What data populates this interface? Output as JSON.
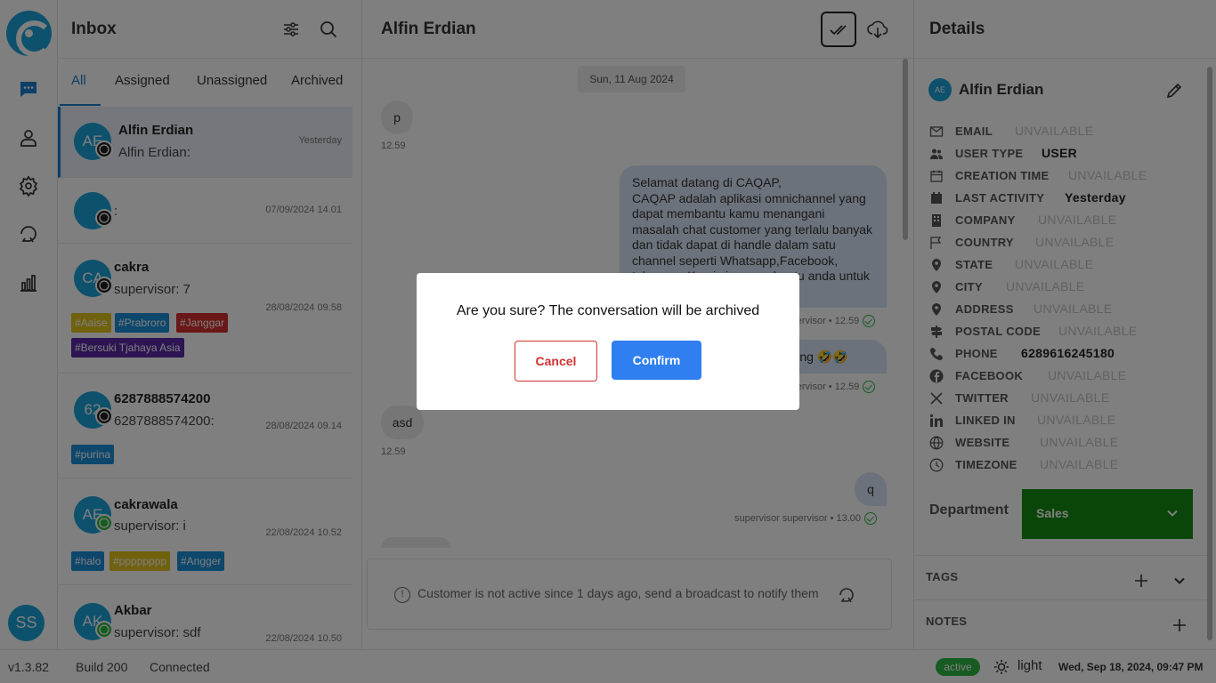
{
  "brand": {
    "accent": "#1aa3d8"
  },
  "rail": {
    "user_initials": "SS"
  },
  "inbox": {
    "title": "Inbox",
    "tabs": [
      {
        "label": "All",
        "active": true
      },
      {
        "label": "Assigned",
        "active": false
      },
      {
        "label": "Unassigned",
        "active": false
      },
      {
        "label": "Archived",
        "active": false
      }
    ],
    "conversations": [
      {
        "initials": "AE",
        "name": "Alfin Erdian",
        "preview": "Alfin Erdian:",
        "time": "Yesterday",
        "channel": "whatsapp-business",
        "selected": true,
        "tags": []
      },
      {
        "initials": "",
        "name": "",
        "preview": ":",
        "time": "07/09/2024 14.01",
        "channel": "whatsapp-business",
        "selected": false,
        "tags": []
      },
      {
        "initials": "CA",
        "name": "cakra",
        "preview": "supervisor:  7",
        "time": "28/08/2024 09.58",
        "channel": "whatsapp-business",
        "selected": false,
        "tags": [
          {
            "label": "#Aaise",
            "color": "#e0c21a"
          },
          {
            "label": "#Prabroro",
            "color": "#1a8fd8"
          },
          {
            "label": "#Janggar",
            "color": "#d32f2f"
          },
          {
            "label": "#Bersuki Tjahaya Asia",
            "color": "#5a2aa8"
          }
        ]
      },
      {
        "initials": "62",
        "name": "6287888574200",
        "preview": "6287888574200:",
        "time": "28/08/2024 09.14",
        "channel": "whatsapp-business",
        "selected": false,
        "tags": [
          {
            "label": "#purina",
            "color": "#1a8fd8"
          }
        ]
      },
      {
        "initials": "AE",
        "name": "cakrawala",
        "preview": "supervisor:  i",
        "time": "22/08/2024 10.52",
        "channel": "whatsapp",
        "selected": false,
        "tags": [
          {
            "label": "#halo",
            "color": "#1a8fd8"
          },
          {
            "label": "#pppppppp",
            "color": "#e0c21a"
          },
          {
            "label": "#Angger",
            "color": "#1a8fd8"
          }
        ]
      },
      {
        "initials": "AK",
        "name": "Akbar",
        "preview": "supervisor:  sdf",
        "time": "22/08/2024 10.50",
        "channel": "whatsapp",
        "selected": false,
        "tags": []
      }
    ]
  },
  "chat": {
    "title": "Alfin Erdian",
    "date_chip": "Sun, 11 Aug 2024",
    "messages": [
      {
        "dir": "in",
        "text": "p",
        "meta": "12.59"
      },
      {
        "dir": "out",
        "text": "Selamat datang di CAQAP,\nCAQAP adalah aplikasi omnichannel yang dapat membantu kamu menangani masalah chat customer yang terlalu banyak dan tidak dapat di handle dalam satu channel seperti Whatsapp,Facebook, telegram. Kami siap membantu anda untuk membuat dashboard.",
        "meta": "supervisor • 12.59"
      },
      {
        "dir": "out",
        "text": "banting 🤣🤣",
        "meta": "supervisor • 12.59"
      },
      {
        "dir": "in",
        "text": "asd",
        "meta": "12.59"
      },
      {
        "dir": "out",
        "text": "q",
        "meta": "supervisor supervisor • 13.00"
      }
    ],
    "notice": "Customer is not active since 1 days ago, send a broadcast to notify them"
  },
  "details": {
    "title": "Details",
    "contact_initials": "AE",
    "contact_name": "Alfin Erdian",
    "fields": [
      {
        "icon": "mail-icon",
        "label": "EMAIL",
        "value": "UNVAILABLE",
        "known": false
      },
      {
        "icon": "users-icon",
        "label": "USER TYPE",
        "value": "USER",
        "known": true
      },
      {
        "icon": "calendar-icon",
        "label": "CREATION TIME",
        "value": "UNVAILABLE",
        "known": false
      },
      {
        "icon": "calendar-filled-icon",
        "label": "LAST ACTIVITY",
        "value": "Yesterday",
        "known": true
      },
      {
        "icon": "building-icon",
        "label": "COMPANY",
        "value": "UNVAILABLE",
        "known": false
      },
      {
        "icon": "flag-icon",
        "label": "COUNTRY",
        "value": "UNVAILABLE",
        "known": false
      },
      {
        "icon": "pin-icon",
        "label": "STATE",
        "value": "UNVAILABLE",
        "known": false
      },
      {
        "icon": "pin-icon",
        "label": "CITY",
        "value": "UNVAILABLE",
        "known": false
      },
      {
        "icon": "pin-icon",
        "label": "ADDRESS",
        "value": "UNVAILABLE",
        "known": false
      },
      {
        "icon": "signpost-icon",
        "label": "POSTAL CODE",
        "value": "UNVAILABLE",
        "known": false
      },
      {
        "icon": "phone-icon",
        "label": "PHONE",
        "value": "6289616245180",
        "known": true
      },
      {
        "icon": "facebook-icon",
        "label": "FACEBOOK",
        "value": "UNVAILABLE",
        "known": false
      },
      {
        "icon": "x-twitter-icon",
        "label": "TWITTER",
        "value": "UNVAILABLE",
        "known": false
      },
      {
        "icon": "linkedin-icon",
        "label": "LINKED IN",
        "value": "UNVAILABLE",
        "known": false
      },
      {
        "icon": "globe-icon",
        "label": "WEBSITE",
        "value": "UNVAILABLE",
        "known": false
      },
      {
        "icon": "clock-icon",
        "label": "TIMEZONE",
        "value": "UNVAILABLE",
        "known": false
      }
    ],
    "department_label": "Department",
    "department_value": "Sales",
    "department_color": "#148a14",
    "tags_label": "TAGS",
    "notes_label": "NOTES"
  },
  "statusbar": {
    "version": "v1.3.82",
    "build": "Build 200",
    "connection": "Connected",
    "status": "active",
    "theme": "light",
    "datetime": "Wed, Sep 18, 2024, 09:47 PM"
  },
  "modal": {
    "message": "Are you sure? The conversation will be archived",
    "cancel_label": "Cancel",
    "confirm_label": "Confirm",
    "cancel_color": "#d32f2f",
    "confirm_color": "#2f7ff0"
  }
}
